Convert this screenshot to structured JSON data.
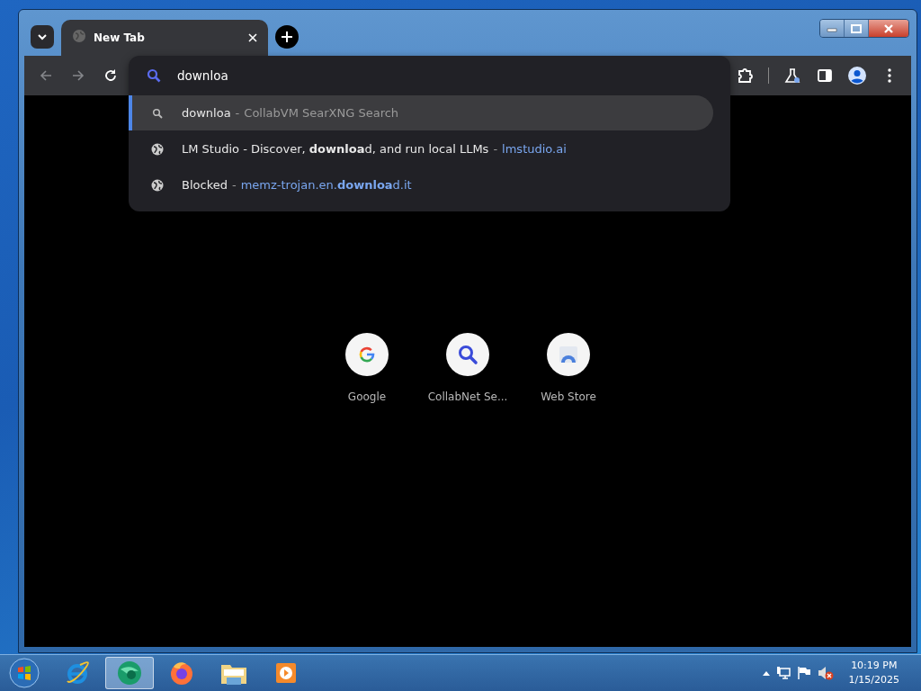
{
  "tabs": [
    {
      "title": "New Tab",
      "selected": true
    }
  ],
  "toolbar": {
    "back_disabled": true,
    "forward_disabled": true
  },
  "omnibox": {
    "value": "downloa",
    "suggestions": [
      {
        "kind": "search",
        "text": "downloa",
        "separator": "-",
        "detail": "CollabVM SearXNG Search",
        "selected": true
      },
      {
        "kind": "site",
        "text": "LM Studio - Discover, **downloa**d, and run local LLMs",
        "separator": "-",
        "detail": "lmstudio.ai",
        "selected": false
      },
      {
        "kind": "site",
        "text": "Blocked",
        "separator": "-",
        "detail": "memz-trojan.en.**downloa**d.it",
        "selected": false
      }
    ]
  },
  "shortcuts": [
    {
      "kind": "google",
      "title": "Google"
    },
    {
      "kind": "search",
      "title": "CollabNet Se..."
    },
    {
      "kind": "store",
      "title": "Web Store"
    }
  ],
  "taskbar": {
    "apps": [
      {
        "kind": "ie",
        "active": false
      },
      {
        "kind": "browser",
        "active": true
      },
      {
        "kind": "firefox",
        "active": false
      },
      {
        "kind": "folder",
        "active": false
      },
      {
        "kind": "media",
        "active": false
      }
    ],
    "clock": {
      "time": "10:19 PM",
      "date": "1/15/2025"
    }
  }
}
